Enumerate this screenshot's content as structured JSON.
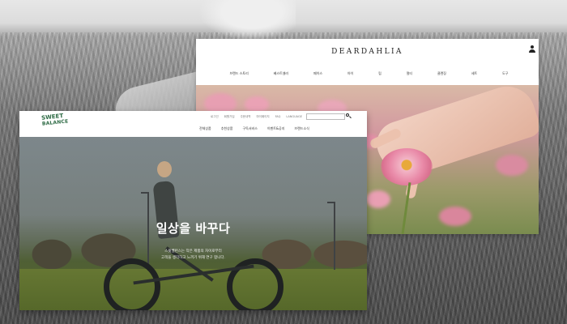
{
  "dear_dahlia": {
    "logo": "DEARDAHLIA",
    "nav": [
      "브랜드 스토리",
      "베스트셀러",
      "페이스",
      "아이",
      "립",
      "멀티",
      "클렌징",
      "세트",
      "도구"
    ]
  },
  "sweet_balance": {
    "logo_line1": "SWEET",
    "logo_line2": "BALANCE",
    "util": [
      "로그인",
      "회원가입",
      "주문내역",
      "마이페이지",
      "FAQ",
      "LANGUAGE"
    ],
    "nav": [
      "전체상품",
      "추천상품",
      "구독서비스",
      "이벤트&공지",
      "브랜드소식"
    ],
    "hero": {
      "heading": "일상을 바꾸다",
      "subline1": "스윗밸런스는 작은 제품의 차이로부터",
      "subline2": "고객을 생각하고 느끼기 위해 연구 합니다."
    }
  },
  "colors": {
    "sb_brand_green": "#2e6b45"
  }
}
